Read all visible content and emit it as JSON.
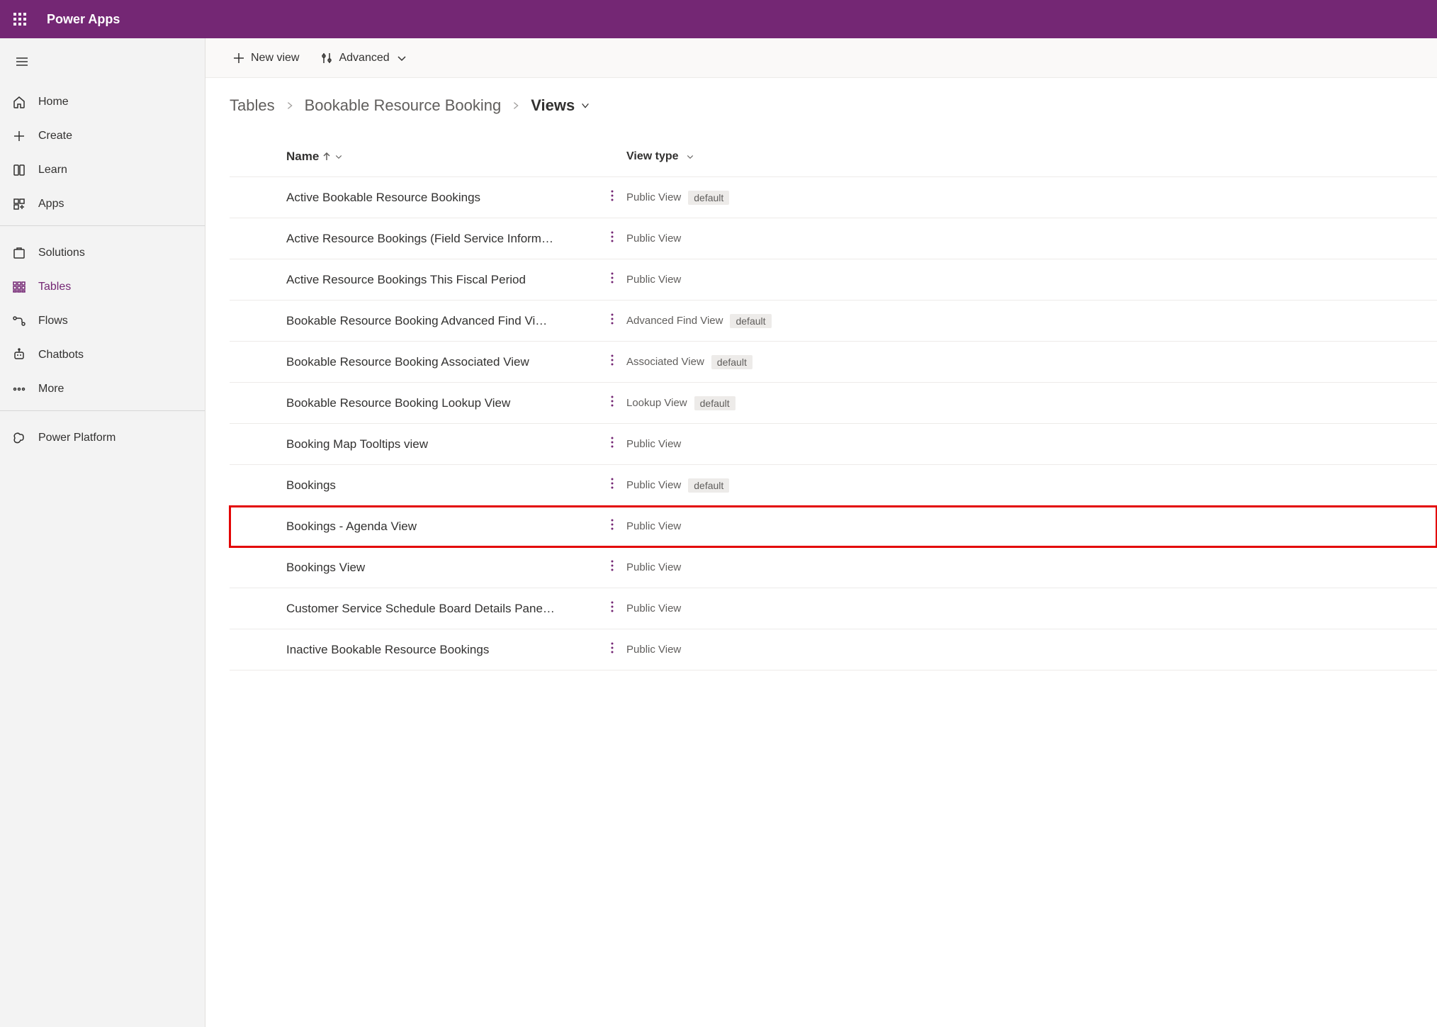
{
  "header": {
    "app_title": "Power Apps"
  },
  "sidebar": {
    "items": [
      {
        "label": "Home",
        "icon": "home",
        "active": false
      },
      {
        "label": "Create",
        "icon": "plus",
        "active": false
      },
      {
        "label": "Learn",
        "icon": "book",
        "active": false
      },
      {
        "label": "Apps",
        "icon": "apps",
        "active": false
      }
    ],
    "items2": [
      {
        "label": "Solutions",
        "icon": "solutions",
        "active": false
      },
      {
        "label": "Tables",
        "icon": "tables",
        "active": true
      },
      {
        "label": "Flows",
        "icon": "flows",
        "active": false
      },
      {
        "label": "Chatbots",
        "icon": "chatbots",
        "active": false
      },
      {
        "label": "More",
        "icon": "more",
        "active": false
      }
    ],
    "items3": [
      {
        "label": "Power Platform",
        "icon": "platform",
        "active": false
      }
    ]
  },
  "toolbar": {
    "new_view": "New view",
    "advanced": "Advanced"
  },
  "breadcrumb": {
    "root": "Tables",
    "entity": "Bookable Resource Booking",
    "current": "Views"
  },
  "columns": {
    "name": "Name",
    "view_type": "View type"
  },
  "rows": [
    {
      "name": "Active Bookable Resource Bookings",
      "type": "Public View",
      "default": true,
      "highlighted": false
    },
    {
      "name": "Active Resource Bookings (Field Service Inform…",
      "type": "Public View",
      "default": false,
      "highlighted": false
    },
    {
      "name": "Active Resource Bookings This Fiscal Period",
      "type": "Public View",
      "default": false,
      "highlighted": false
    },
    {
      "name": "Bookable Resource Booking Advanced Find Vi…",
      "type": "Advanced Find View",
      "default": true,
      "highlighted": false
    },
    {
      "name": "Bookable Resource Booking Associated View",
      "type": "Associated View",
      "default": true,
      "highlighted": false
    },
    {
      "name": "Bookable Resource Booking Lookup View",
      "type": "Lookup View",
      "default": true,
      "highlighted": false
    },
    {
      "name": "Booking Map Tooltips view",
      "type": "Public View",
      "default": false,
      "highlighted": false
    },
    {
      "name": "Bookings",
      "type": "Public View",
      "default": true,
      "highlighted": false
    },
    {
      "name": "Bookings - Agenda View",
      "type": "Public View",
      "default": false,
      "highlighted": true
    },
    {
      "name": "Bookings View",
      "type": "Public View",
      "default": false,
      "highlighted": false
    },
    {
      "name": "Customer Service Schedule Board Details Pane…",
      "type": "Public View",
      "default": false,
      "highlighted": false
    },
    {
      "name": "Inactive Bookable Resource Bookings",
      "type": "Public View",
      "default": false,
      "highlighted": false
    }
  ],
  "default_label": "default"
}
